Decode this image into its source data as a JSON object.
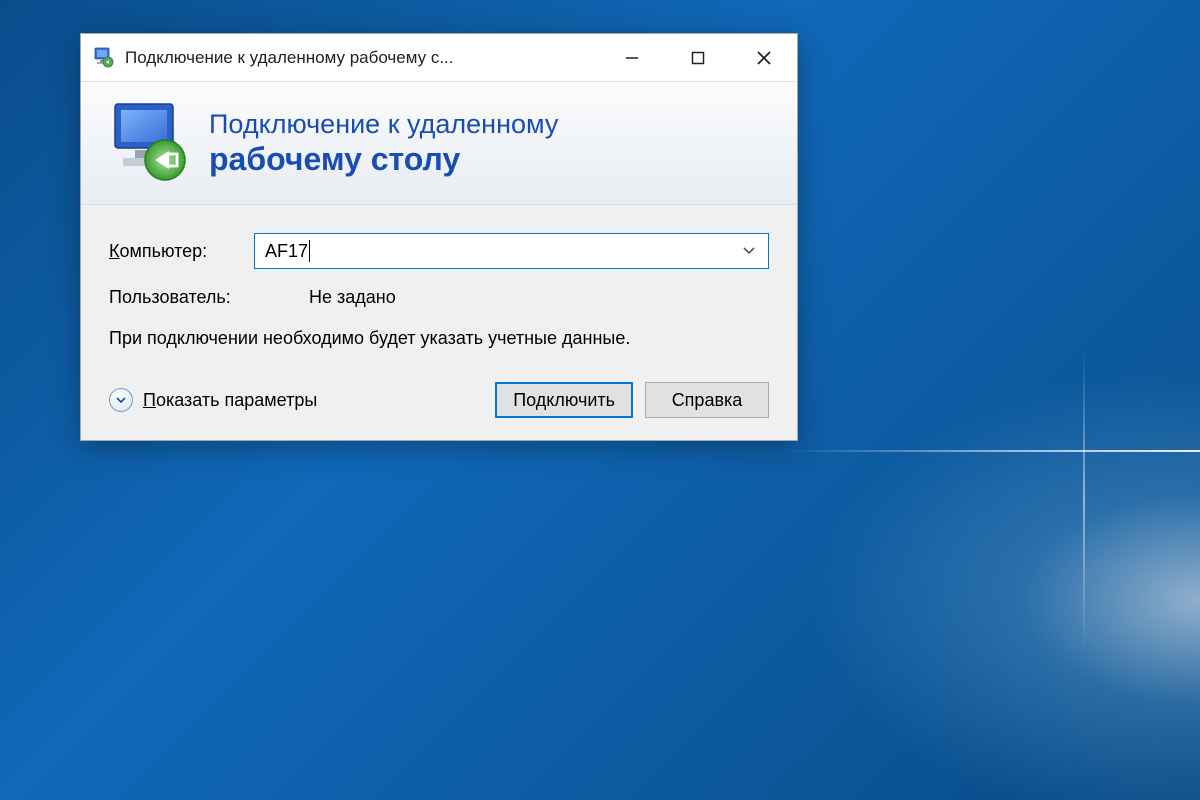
{
  "window": {
    "title": "Подключение к удаленному рабочему с..."
  },
  "header": {
    "line1": "Подключение к удаленному",
    "line2": "рабочему столу"
  },
  "form": {
    "computer_label": "Компьютер:",
    "computer_value": "AF17",
    "user_label": "Пользователь:",
    "user_value": "Не задано",
    "info": "При подключении необходимо будет указать учетные данные."
  },
  "footer": {
    "show_options": "Показать параметры",
    "connect": "Подключить",
    "help": "Справка"
  }
}
